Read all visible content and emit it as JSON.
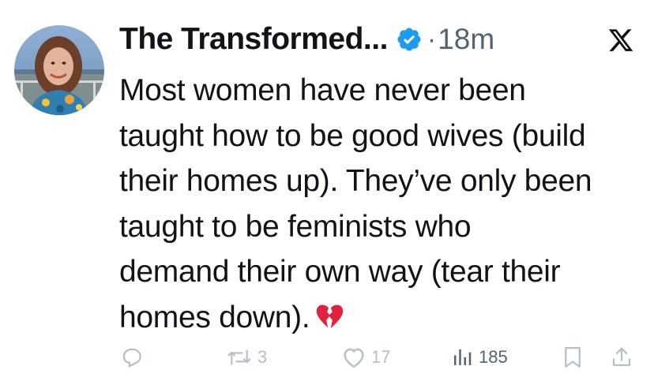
{
  "author": {
    "display_name": "The Transformed...",
    "verified": true,
    "separator": "·",
    "time": "18m"
  },
  "tweet": {
    "lines": [
      "Most women have never been",
      "taught how to be good wives (build",
      "their homes up). They’ve only been",
      "taught to be feminists who",
      "demand their own way (tear their",
      "homes down)."
    ],
    "emoji": "broken-heart"
  },
  "actions": {
    "reply": {
      "icon": "reply-icon",
      "count": ""
    },
    "repost": {
      "icon": "repost-icon",
      "count": "3"
    },
    "like": {
      "icon": "heart-icon",
      "count": "17"
    },
    "views": {
      "icon": "views-icon",
      "count": "185"
    },
    "bookmark": {
      "icon": "bookmark-icon"
    },
    "share": {
      "icon": "share-icon"
    }
  },
  "colors": {
    "text": "#0f1419",
    "secondary": "#536471",
    "verified": "#1d9bf0",
    "action_icons": "#b5bfc7",
    "emoji": "#e0233d"
  }
}
